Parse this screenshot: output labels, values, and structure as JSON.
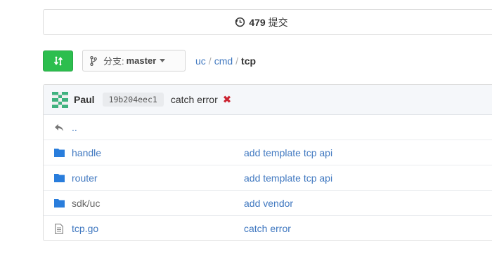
{
  "commits": {
    "count": "479",
    "label": "提交",
    "icon": "history-icon"
  },
  "toolbar": {
    "compare_icon": "compare-icon",
    "branch_prefix": "分支:",
    "branch_name": "master"
  },
  "breadcrumb": {
    "parts": [
      "uc",
      "cmd"
    ],
    "current": "tcp"
  },
  "last_commit": {
    "author": "Paul",
    "sha": "19b204eec1",
    "message": "catch error",
    "status_icon": "✖",
    "status_color": "#cb2431"
  },
  "parent_dir": {
    "label": "..",
    "icon": "back-arrow-icon"
  },
  "files": [
    {
      "name": "handle",
      "type": "directory",
      "message": "add template tcp api"
    },
    {
      "name": "router",
      "type": "directory",
      "message": "add template tcp api"
    },
    {
      "name": "sdk/uc",
      "type": "directory",
      "message": "add vendor"
    },
    {
      "name": "tcp.go",
      "type": "file",
      "message": "catch error"
    }
  ],
  "colors": {
    "accent_green": "#2cbe4e",
    "link_blue": "#4078c0",
    "folder_blue": "#0366d6"
  }
}
